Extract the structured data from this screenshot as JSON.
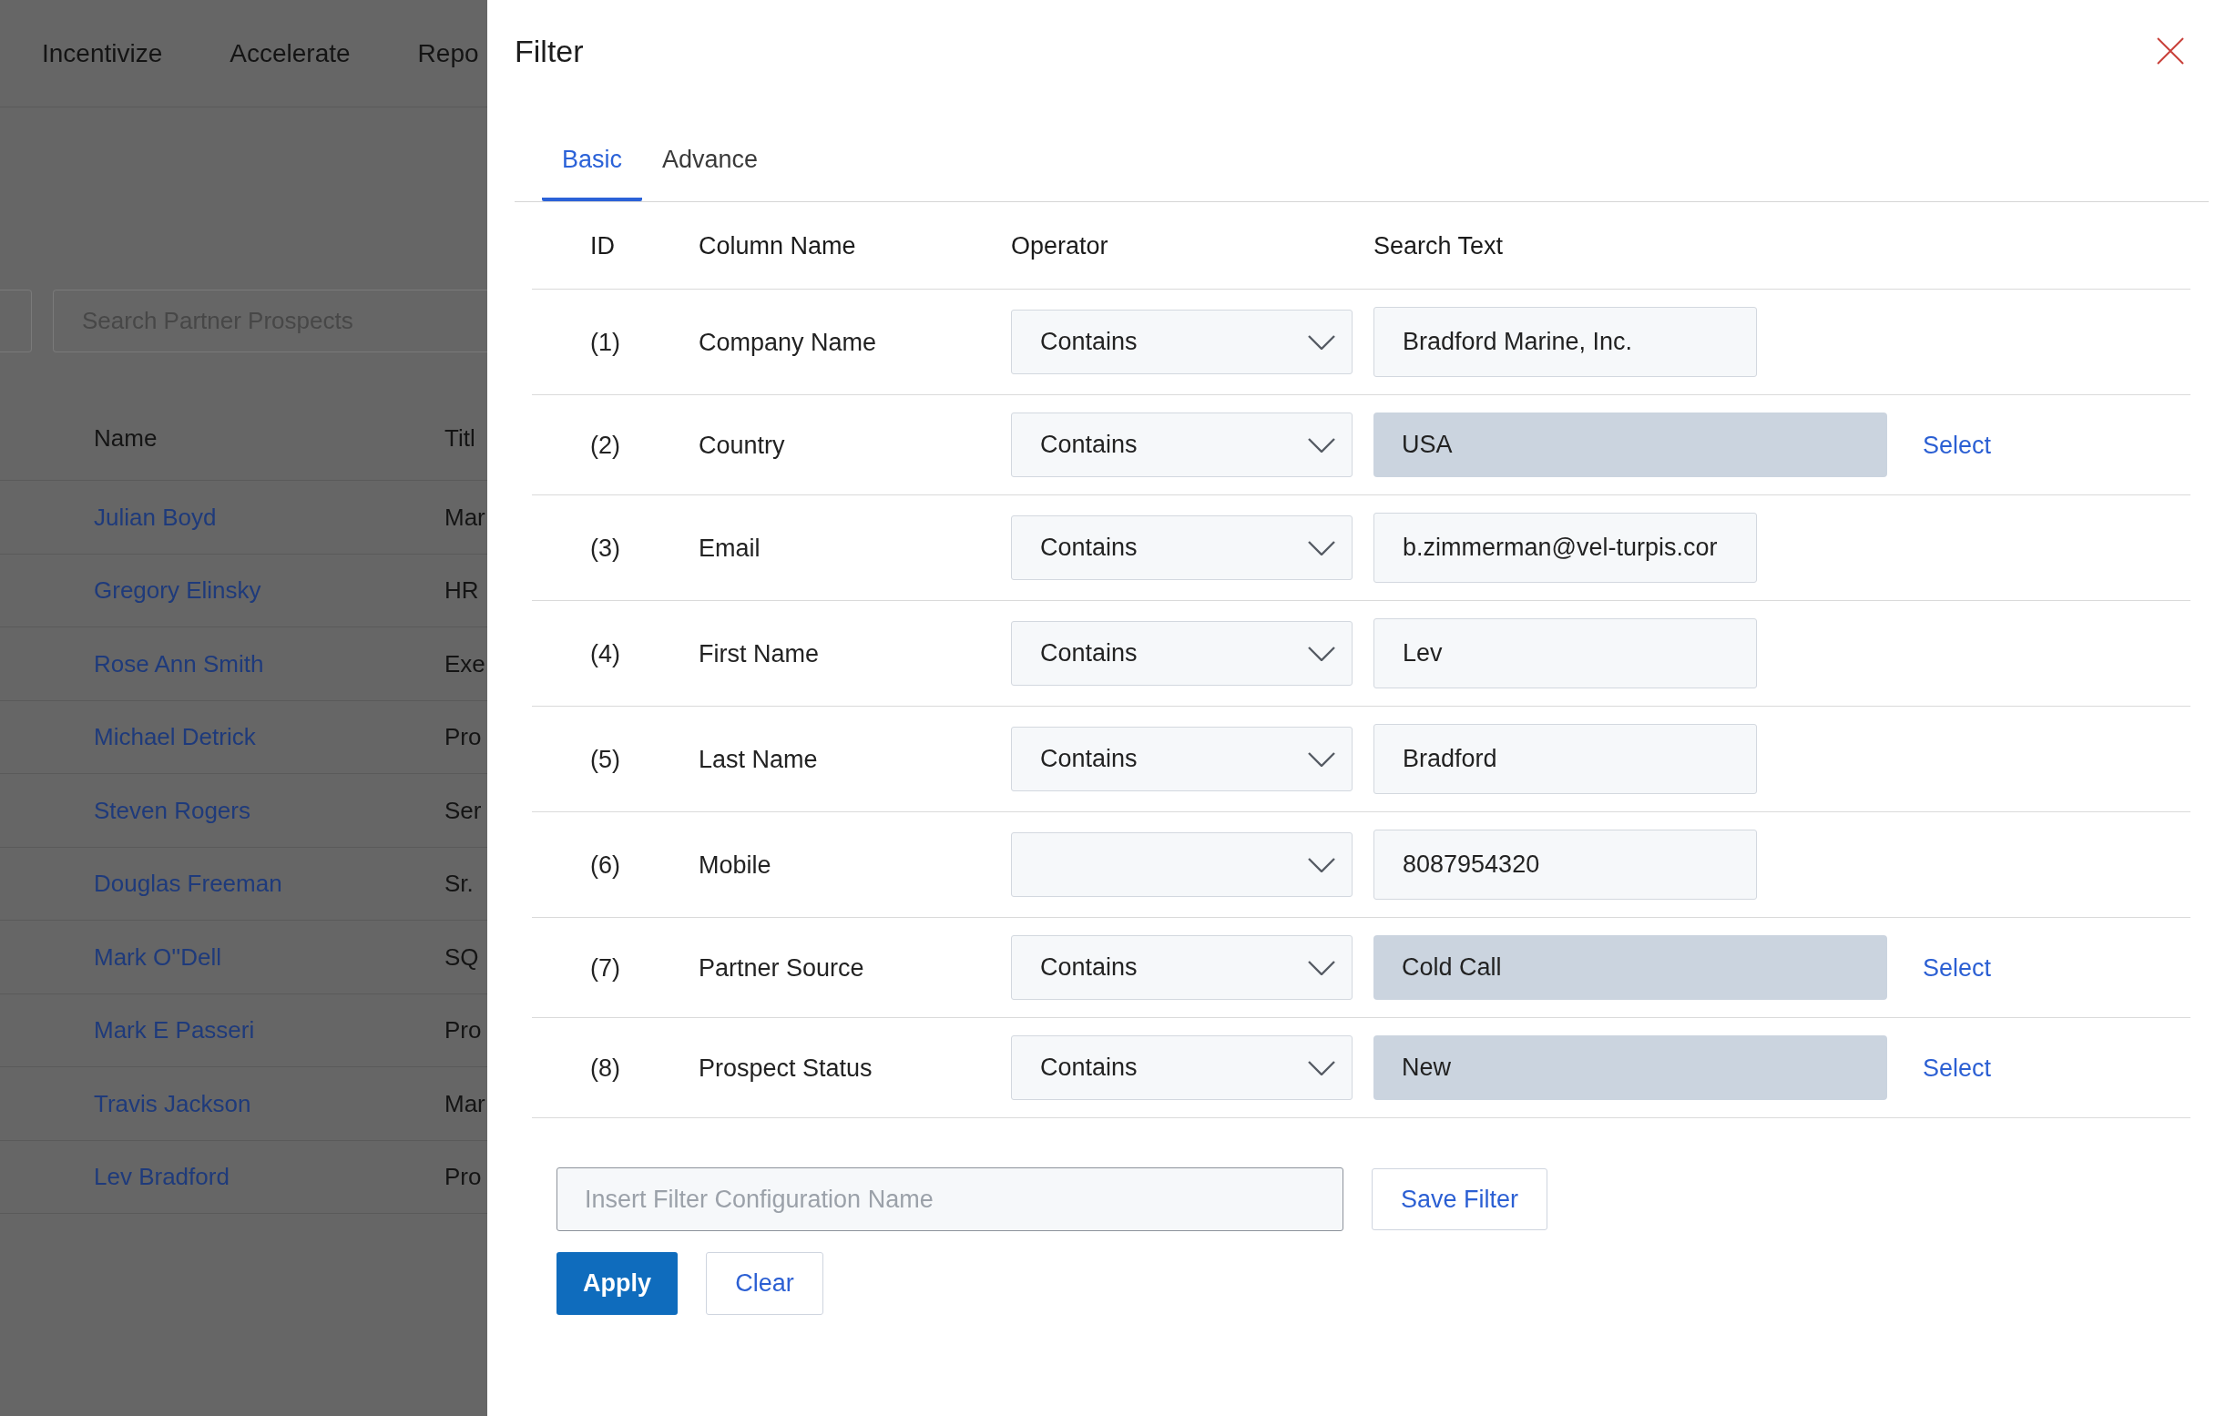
{
  "background_page": {
    "nav": [
      "Incentivize",
      "Accelerate",
      "Repo"
    ],
    "search": {
      "placeholder": "Search Partner Prospects"
    },
    "table": {
      "columns": [
        "Name",
        "Titl"
      ],
      "rows": [
        {
          "name": "Julian Boyd",
          "title": "Mar"
        },
        {
          "name": "Gregory Elinsky",
          "title": "HR"
        },
        {
          "name": "Rose Ann Smith",
          "title": "Exe"
        },
        {
          "name": "Michael Detrick",
          "title": "Pro"
        },
        {
          "name": "Steven Rogers",
          "title": "Ser"
        },
        {
          "name": "Douglas Freeman",
          "title": "Sr."
        },
        {
          "name": "Mark O''Dell",
          "title": "SQ"
        },
        {
          "name": "Mark E Passeri",
          "title": "Pro"
        },
        {
          "name": "Travis Jackson",
          "title": "Mar"
        },
        {
          "name": "Lev Bradford",
          "title": "Pro"
        }
      ]
    }
  },
  "filter_panel": {
    "title": "Filter",
    "tabs": [
      {
        "label": "Basic",
        "selected": true
      },
      {
        "label": "Advance",
        "selected": false
      }
    ],
    "columns": [
      "ID",
      "Column Name",
      "Operator",
      "Search Text"
    ],
    "rows": [
      {
        "id": "(1)",
        "column": "Company Name",
        "operator": "Contains",
        "kind": "text",
        "value": "Bradford Marine, Inc."
      },
      {
        "id": "(2)",
        "column": "Country",
        "operator": "Contains",
        "kind": "picker",
        "value": "USA",
        "action": "Select"
      },
      {
        "id": "(3)",
        "column": "Email",
        "operator": "Contains",
        "kind": "text",
        "value": "b.zimmerman@vel-turpis.cor"
      },
      {
        "id": "(4)",
        "column": "First Name",
        "operator": "Contains",
        "kind": "text",
        "value": "Lev"
      },
      {
        "id": "(5)",
        "column": "Last Name",
        "operator": "Contains",
        "kind": "text",
        "value": "Bradford"
      },
      {
        "id": "(6)",
        "column": "Mobile",
        "kind": "text",
        "value": "8087954320"
      },
      {
        "id": "(7)",
        "column": "Partner Source",
        "operator": "Contains",
        "kind": "picker",
        "value": "Cold Call",
        "action": "Select"
      },
      {
        "id": "(8)",
        "column": "Prospect Status",
        "operator": "Contains",
        "kind": "picker",
        "value": "New",
        "action": "Select"
      }
    ],
    "config_name": {
      "placeholder": "Insert Filter Configuration Name"
    },
    "save_button": "Save Filter",
    "apply_button": "Apply",
    "clear_button": "Clear"
  }
}
